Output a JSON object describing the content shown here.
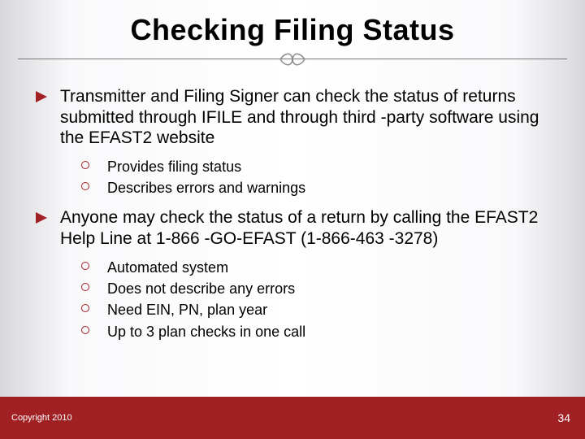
{
  "title": "Checking Filing Status",
  "bullets": [
    {
      "text": "Transmitter and Filing Signer can check the status of returns submitted through IFILE and through third -party software using the EFAST2 website",
      "subs": [
        "Provides filing status",
        "Describes errors and warnings"
      ]
    },
    {
      "text": "Anyone may check the status of a return by calling the EFAST2 Help Line at 1-866 -GO-EFAST (1-866-463 -3278)",
      "subs": [
        "Automated system",
        "Does not describe any errors",
        "Need EIN, PN, plan year",
        "Up to 3 plan checks in one call"
      ]
    }
  ],
  "footer": {
    "copyright": "Copyright 2010",
    "page": "34"
  }
}
